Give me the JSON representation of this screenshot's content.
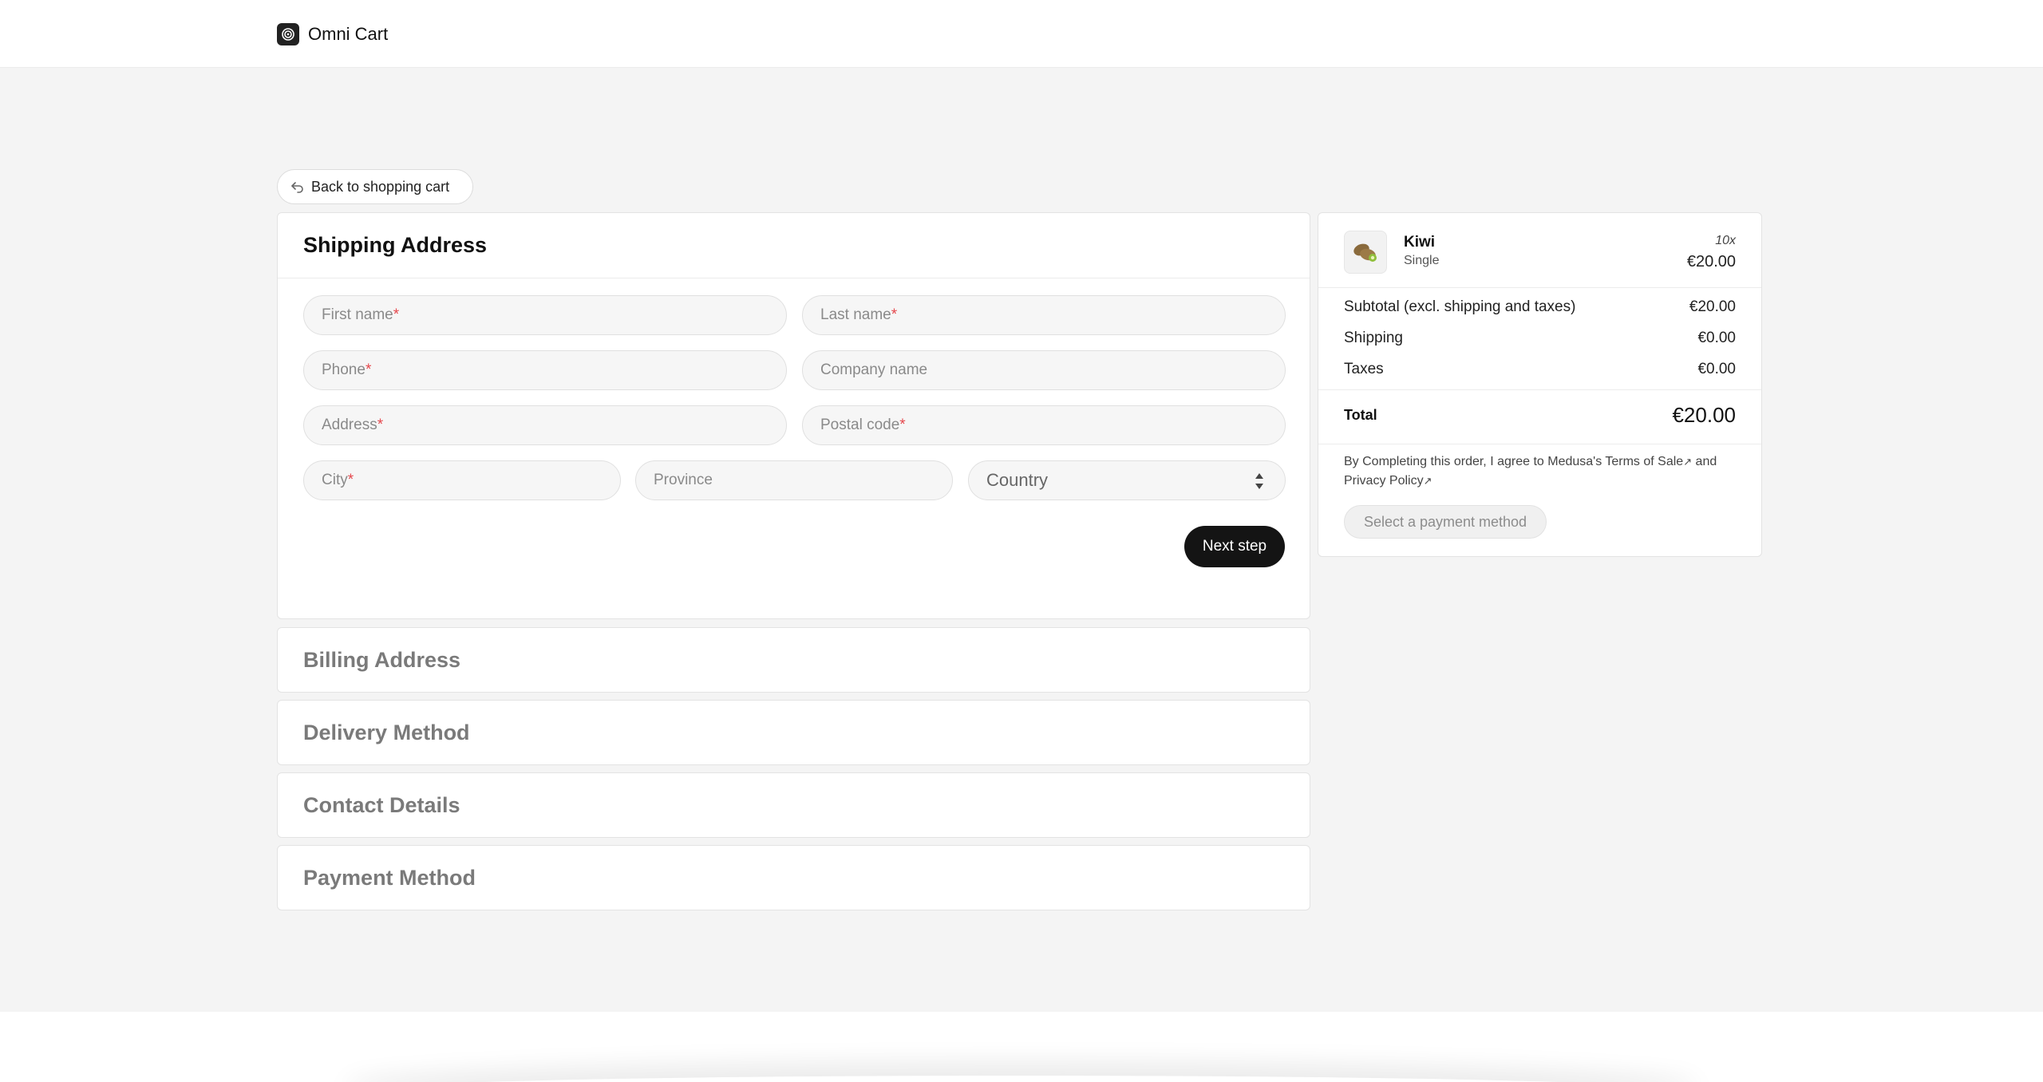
{
  "brand": {
    "name": "Omni Cart"
  },
  "nav": {
    "back_label": "Back to shopping cart"
  },
  "shipping": {
    "title": "Shipping Address",
    "fields": {
      "first_name": {
        "placeholder": "First name",
        "required": "*"
      },
      "last_name": {
        "placeholder": "Last name",
        "required": "*"
      },
      "phone": {
        "placeholder": "Phone",
        "required": "*"
      },
      "company": {
        "placeholder": "Company name"
      },
      "address": {
        "placeholder": "Address",
        "required": "*"
      },
      "postal_code": {
        "placeholder": "Postal code",
        "required": "*"
      },
      "city": {
        "placeholder": "City",
        "required": "*"
      },
      "province": {
        "placeholder": "Province"
      },
      "country": {
        "selected": "Country"
      }
    },
    "next_label": "Next step"
  },
  "sections": {
    "billing": "Billing Address",
    "delivery": "Delivery Method",
    "contact": "Contact Details",
    "payment": "Payment Method"
  },
  "summary": {
    "item": {
      "name": "Kiwi",
      "variant": "Single",
      "quantity": "10x",
      "price": "€20.00"
    },
    "lines": {
      "subtotal_label": "Subtotal (excl. shipping and taxes)",
      "subtotal_value": "€20.00",
      "shipping_label": "Shipping",
      "shipping_value": "€0.00",
      "taxes_label": "Taxes",
      "taxes_value": "€0.00",
      "total_label": "Total",
      "total_value": "€20.00"
    },
    "terms": {
      "prefix": "By Completing this order, I agree to Medusa's",
      "terms_link": "Terms of Sale",
      "conjunction": "and",
      "privacy_link": "Privacy Policy"
    },
    "pay_button": "Select a payment method"
  },
  "colors": {
    "page_bg": "#f4f4f4",
    "primary_button": "#141414",
    "required": "#e5484d"
  }
}
